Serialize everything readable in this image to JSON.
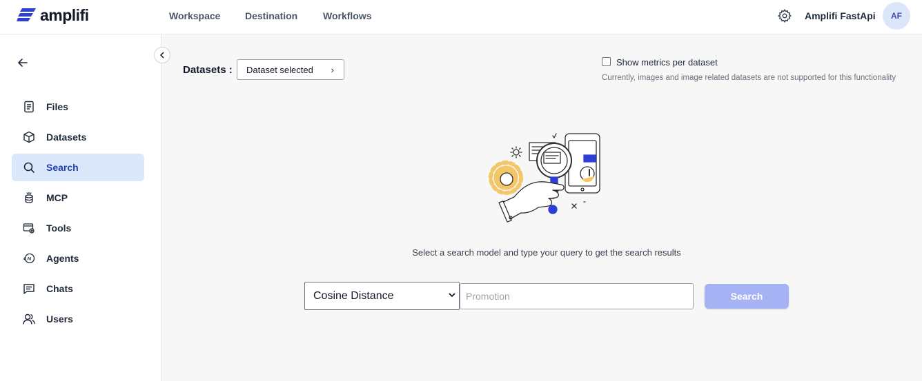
{
  "app": {
    "brand": "amplifi",
    "accent_color": "#2f3fd6",
    "user_name": "Amplifi FastApi",
    "user_initials": "AF"
  },
  "topnav": {
    "links": [
      "Workspace",
      "Destination",
      "Workflows"
    ]
  },
  "sidebar": {
    "items": [
      {
        "label": "Files",
        "icon": "file-icon",
        "active": false
      },
      {
        "label": "Datasets",
        "icon": "cube-icon",
        "active": false
      },
      {
        "label": "Search",
        "icon": "search-icon",
        "active": true
      },
      {
        "label": "MCP",
        "icon": "mcp-icon",
        "active": false
      },
      {
        "label": "Tools",
        "icon": "tools-icon",
        "active": false
      },
      {
        "label": "Agents",
        "icon": "ai-agent-icon",
        "active": false
      },
      {
        "label": "Chats",
        "icon": "chat-icon",
        "active": false
      },
      {
        "label": "Users",
        "icon": "users-icon",
        "active": false
      }
    ]
  },
  "search_page": {
    "datasets_label": "Datasets :",
    "dataset_button": "Dataset selected",
    "metrics_checkbox_label": "Show metrics per dataset",
    "metrics_checked": false,
    "metrics_note": "Currently, images and image related datasets are not supported for this functionality",
    "hint": "Select a search model and type your query to get the search results",
    "model_select_value": "Cosine Distance",
    "query_placeholder": "Promotion",
    "search_button": "Search",
    "search_button_color": "#a5b2f4"
  }
}
